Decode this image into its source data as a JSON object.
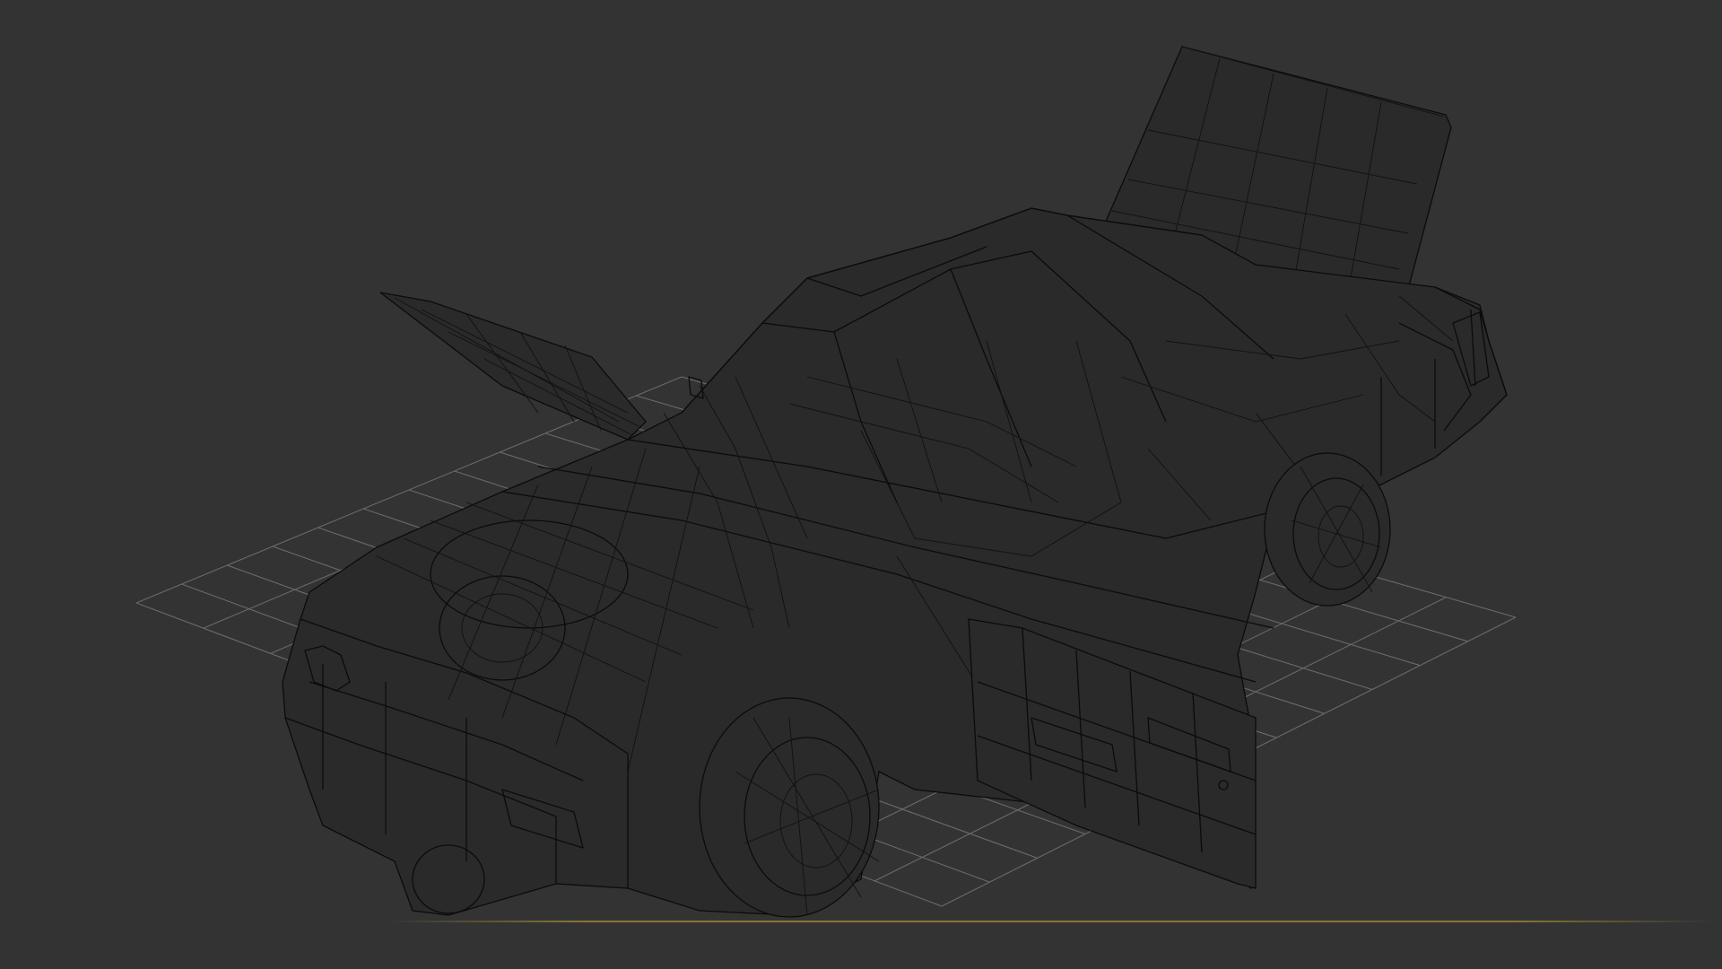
{
  "viewport": {
    "background": "#333333",
    "grid_color": "#6a6a6a",
    "wire_color": "#0b0b0b",
    "accent_color": "#8a7432",
    "object": "car-wireframe-model"
  }
}
